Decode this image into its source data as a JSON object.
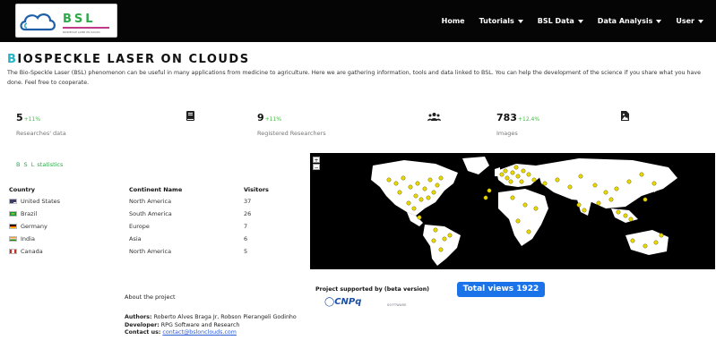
{
  "header": {
    "logo_text": "BSL",
    "logo_subtext": "BIOSPECKLE LASER ON CLOUDS",
    "nav": [
      {
        "label": "Home",
        "dropdown": false
      },
      {
        "label": "Tutorials",
        "dropdown": true
      },
      {
        "label": "BSL Data",
        "dropdown": true
      },
      {
        "label": "Data Analysis",
        "dropdown": true
      },
      {
        "label": "User",
        "dropdown": true
      }
    ]
  },
  "page": {
    "title_first": "B",
    "title_rest": "IOSPECKLE LASER ON CLOUDS",
    "intro": "The Bio-Speckle Laser (BSL) phenomenon can be useful in many applications from medicine to agriculture. Here we are gathering information, tools and data linked to BSL. You can help the development of the science if you share what you have done. Feel free to cooperate."
  },
  "stats": [
    {
      "value": "5",
      "change": "+11%",
      "label": "Researches' data",
      "icon": "book-icon"
    },
    {
      "value": "9",
      "change": "+11%",
      "label": "Registered Researchers",
      "icon": "users-icon"
    },
    {
      "value": "783",
      "change": "+12.4%",
      "label": "Images",
      "icon": "image-icon"
    }
  ],
  "bsl_statistics": {
    "prefix": "B S L",
    "label": "statistics"
  },
  "visitors_table": {
    "headers": [
      "Country",
      "Continent Name",
      "Visitors"
    ],
    "rows": [
      {
        "country": "United States",
        "continent": "North America",
        "visitors": "37",
        "flag": "us"
      },
      {
        "country": "Brazil",
        "continent": "South America",
        "visitors": "26",
        "flag": "br"
      },
      {
        "country": "Germany",
        "continent": "Europe",
        "visitors": "7",
        "flag": "de"
      },
      {
        "country": "India",
        "continent": "Asia",
        "visitors": "6",
        "flag": "in"
      },
      {
        "country": "Canada",
        "continent": "North America",
        "visitors": "5",
        "flag": "ca"
      }
    ]
  },
  "map": {
    "zoom_in": "+",
    "zoom_out": "−",
    "background": "#000000",
    "land": "#ffffff",
    "marker": "#e8d800"
  },
  "footer": {
    "about_title": "About the project",
    "authors_label": "Authors:",
    "authors_value": "Roberto Alves Braga Jr, Robson Pierangeli Godinho",
    "developer_label": "Developer:",
    "developer_value": "RPG Software and Research",
    "contact_label": "Contact us:",
    "contact_value": "contact@bslonclouds.com",
    "supported_by": "Project supported by (beta version)",
    "sponsor": "CNPq",
    "sponsor2": "SOFTWARE",
    "total_views": "Total views 1922"
  }
}
